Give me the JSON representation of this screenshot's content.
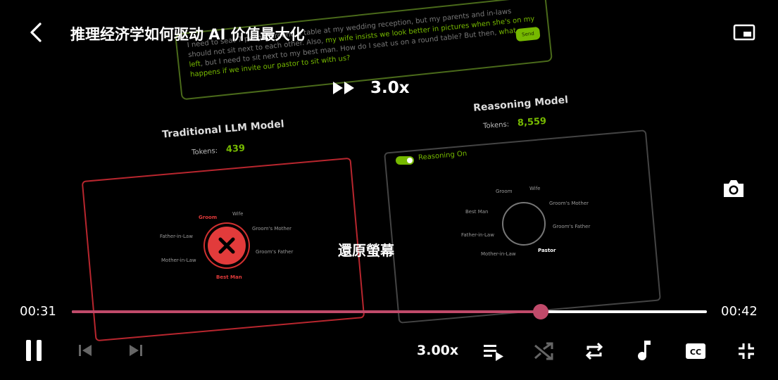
{
  "header": {
    "title": "推理经济学如何驱动 AI 价值最大化"
  },
  "speed_indicator": {
    "label": "3.0x"
  },
  "center_action": {
    "label": "還原螢幕"
  },
  "video": {
    "prompt_part1": "I need to seat 7 people around a table at my wedding reception, but my parents and in-laws should not sit next to each other. Also, ",
    "prompt_hl1": "my wife insists we look better in pictures when she's on my left",
    "prompt_part2": ", but I need to sit next to my best man. How do I seat us on a round table? But then, ",
    "prompt_hl2": "what happens if we invite our pastor to sit with us?",
    "send_label": "Send",
    "left_title": "Traditional LLM Model",
    "left_tokens_label": "Tokens:",
    "left_tokens_value": "439",
    "right_title": "Reasoning Model",
    "right_tokens_label": "Tokens:",
    "right_tokens_value": "8,559",
    "reasoning_label": "Reasoning On",
    "left_nodes": {
      "groom": "Groom",
      "wife": "Wife",
      "father_in_law": "Father-in-Law",
      "grooms_mother": "Groom's Mother",
      "mother_in_law": "Mother-in-Law",
      "grooms_father": "Groom's Father",
      "best_man": "Best Man"
    },
    "right_nodes": {
      "groom": "Groom",
      "wife": "Wife",
      "best_man": "Best Man",
      "grooms_mother": "Groom's Mother",
      "father_in_law": "Father-in-Law",
      "grooms_father": "Groom's Father",
      "mother_in_law": "Mother-in-Law",
      "pastor": "Pastor"
    }
  },
  "player": {
    "current_time": "00:31",
    "total_time": "00:42",
    "progress_fraction": 0.738,
    "speed_label": "3.00x",
    "accent_color": "#c04a6a"
  },
  "icons": {
    "back": "back-arrow-icon",
    "pip": "picture-in-picture-icon",
    "screenshot": "camera-icon",
    "play_pause": "pause-icon",
    "prev": "skip-previous-icon",
    "next": "skip-next-icon",
    "playlist": "playlist-icon",
    "shuffle": "shuffle-icon",
    "repeat": "repeat-icon",
    "audio": "music-note-icon",
    "captions": "closed-captions-icon",
    "exit_fullscreen": "exit-fullscreen-icon"
  }
}
